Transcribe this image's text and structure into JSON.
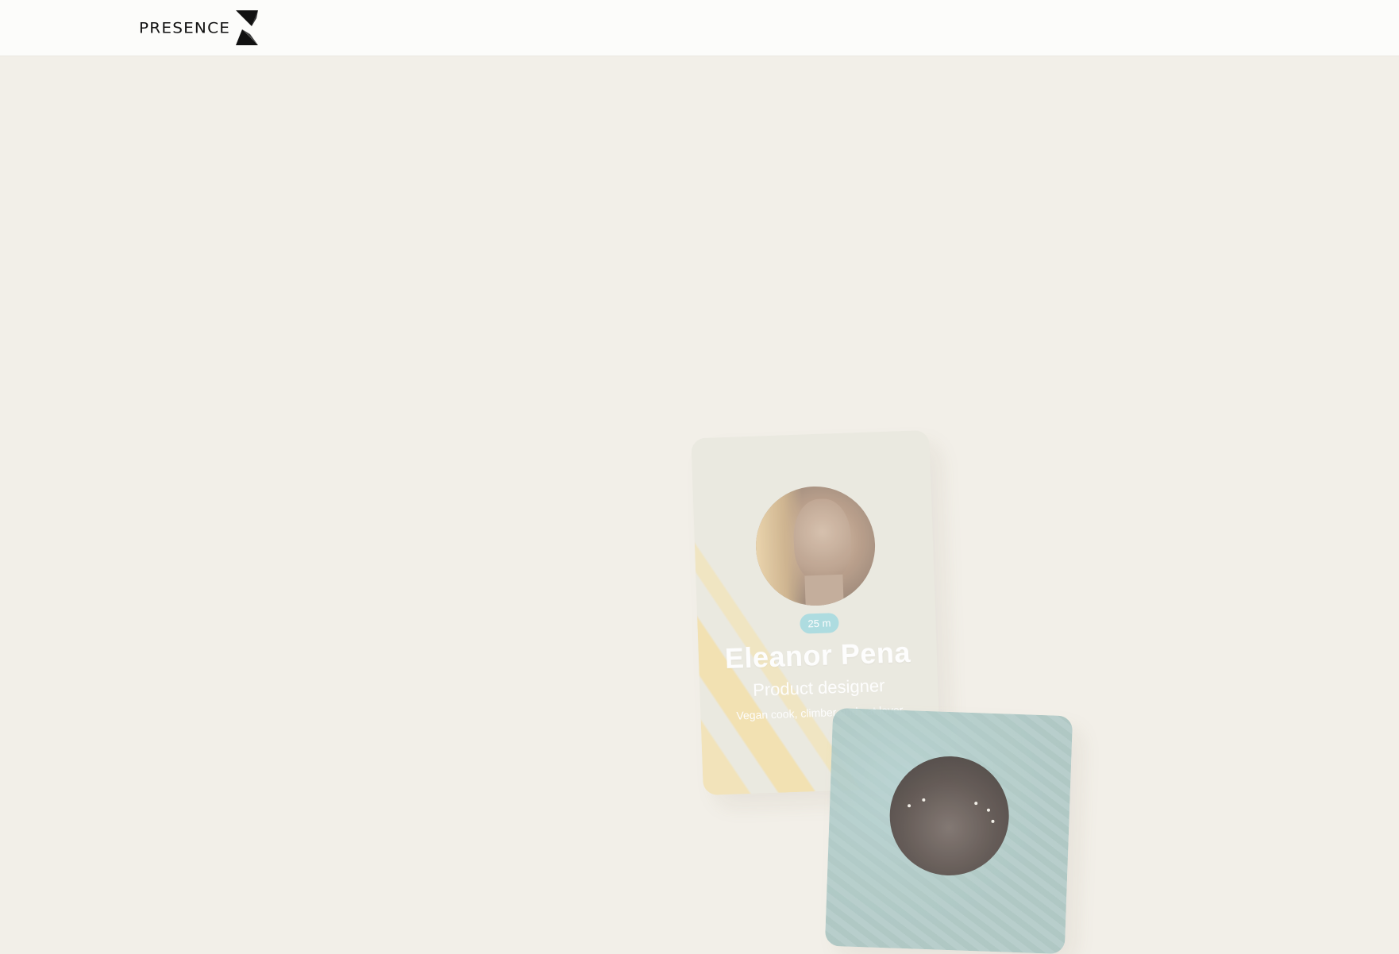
{
  "header": {
    "logo_text": "PRESENCE",
    "logo_icon": "presence-hourglass-icon"
  },
  "cards": [
    {
      "distance": "25 m",
      "name": "Eleanor Pena",
      "role": "Product designer",
      "bio": "Vegan cook, climber and cat lover"
    },
    {
      "distance": "",
      "name": "",
      "role": "",
      "bio": ""
    }
  ],
  "colors": {
    "background": "#f2efe8",
    "header_bg": "#fcfcfa",
    "badge": "#a9dbe0",
    "card1_accent": "#f7da8c",
    "card2_accent": "#b9cecb"
  }
}
